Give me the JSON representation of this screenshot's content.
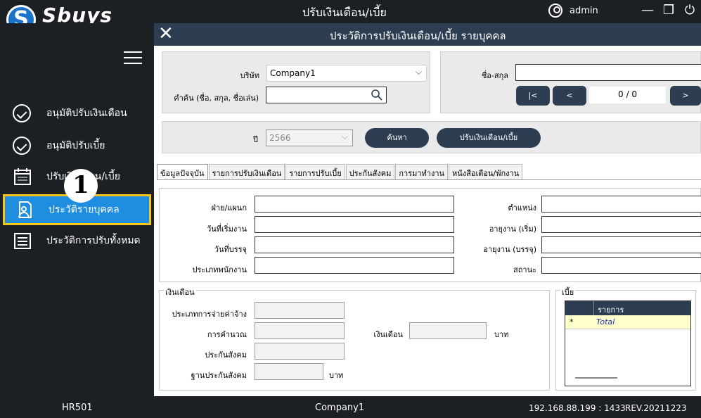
{
  "app": {
    "logo_letter": "S",
    "logo_text": "Sbuys",
    "window_title": "ปรับเงินเดือน/เบี้ย",
    "user": "admin"
  },
  "window_controls": {
    "minimize": "—",
    "restore": "❐",
    "power": "⏻"
  },
  "sidebar": {
    "items": [
      {
        "label": "อนุมัติปรับเงินเดือน",
        "icon": "check-circle-icon"
      },
      {
        "label": "อนุมัติปรับเบี้ย",
        "icon": "check-circle-icon"
      },
      {
        "label": "ปรับเงินเดือน/เบี้ย",
        "icon": "calendar-icon"
      },
      {
        "label": "ประวัติรายบุคคล",
        "icon": "person-doc-icon",
        "selected": true
      },
      {
        "label": "ประวัติการปรับทั้งหมด",
        "icon": "list-icon"
      }
    ],
    "step_badge": "1"
  },
  "dialog": {
    "title": "ประวัติการปรับเงินเดือน/เบี้ย รายบุคคล",
    "close": "✕"
  },
  "filters": {
    "company_label": "บริษัท",
    "company_value": "Company1",
    "search_label": "คำค้น (ชื่อ, สกุล, ชื่อเล่น)",
    "search_value": "",
    "name_label": "ชื่อ-สกุล",
    "name_value": "",
    "nav_first": "|<",
    "nav_prev": "<",
    "nav_counter": "0 / 0",
    "nav_next": ">",
    "year_label": "ปี",
    "year_value": "2566",
    "search_button": "ค้นหา",
    "adjust_button": "ปรับเงินเดือน/เบี้ย"
  },
  "tabs": [
    "ข้อมูลปัจจุบัน",
    "รายการปรับเงินเดือน",
    "รายการปรับเบี้ย",
    "ประกันสังคม",
    "การมาทำงาน",
    "หนังสือเตือน/พักงาน"
  ],
  "info": {
    "dept": "ฝ่าย/แผนก",
    "start": "วันที่เริ่มงาน",
    "confirm": "วันที่บรรจุ",
    "emptype": "ประเภทพนักงาน",
    "position": "ตำแหน่ง",
    "age_start": "อายุงาน (เริ่ม)",
    "age_confirm": "อายุงาน (บรรจุ)",
    "status": "สถานะ"
  },
  "salary": {
    "group": "เงินเดือน",
    "paytype": "ประเภทการจ่ายค่าจ้าง",
    "calc": "การคำนวณ",
    "ss": "ประกันสังคม",
    "ss_base": "ฐานประกันสังคม",
    "salary_label": "เงินเดือน",
    "baht": "บาท"
  },
  "allowance": {
    "group": "เบี้ย",
    "col_item": "รายการ",
    "row_marker": "*",
    "total": "Total"
  },
  "status": {
    "code": "HR501",
    "company": "Company1",
    "server": "192.168.88.199 : 1433",
    "rev": "REV.20211223"
  },
  "colors": {
    "accent": "#1f8ee0",
    "highlight": "#f6c517",
    "header": "#2d3e52",
    "total_row": "#ffffcc"
  }
}
